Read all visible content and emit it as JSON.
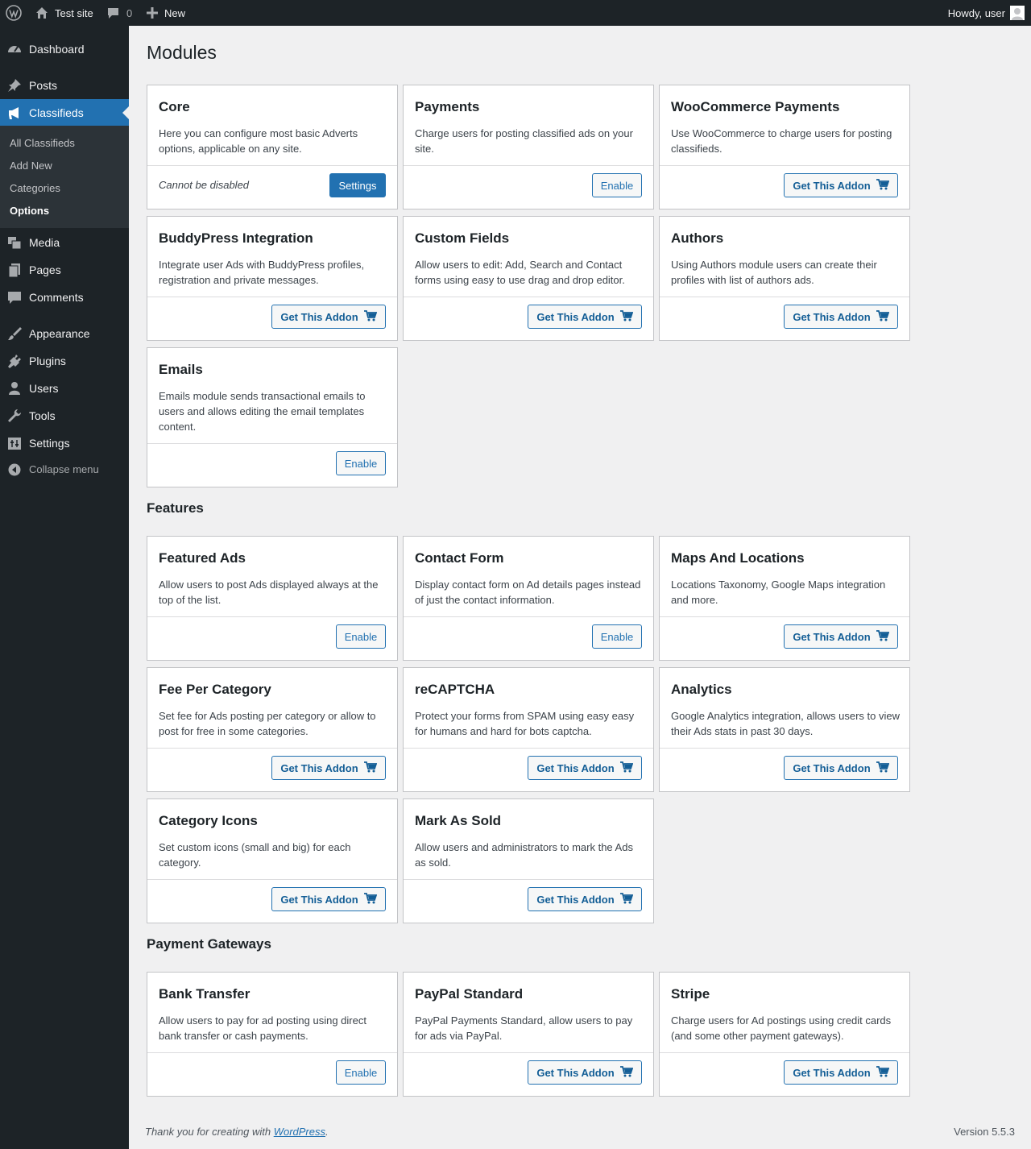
{
  "adminbar": {
    "site_name": "Test site",
    "comments_count": "0",
    "new_label": "New",
    "howdy": "Howdy, user"
  },
  "sidebar": {
    "items": [
      {
        "label": "Dashboard",
        "icon": "dashboard-icon"
      },
      {
        "label": "Posts",
        "icon": "pin-icon"
      },
      {
        "label": "Classifieds",
        "icon": "megaphone-icon"
      },
      {
        "label": "Media",
        "icon": "media-icon"
      },
      {
        "label": "Pages",
        "icon": "pages-icon"
      },
      {
        "label": "Comments",
        "icon": "comment-icon"
      },
      {
        "label": "Appearance",
        "icon": "brush-icon"
      },
      {
        "label": "Plugins",
        "icon": "plug-icon"
      },
      {
        "label": "Users",
        "icon": "user-icon"
      },
      {
        "label": "Tools",
        "icon": "wrench-icon"
      },
      {
        "label": "Settings",
        "icon": "settings-icon"
      }
    ],
    "submenu": [
      "All Classifieds",
      "Add New",
      "Categories",
      "Options"
    ],
    "collapse_label": "Collapse menu"
  },
  "page_title": "Modules",
  "sections": {
    "features": "Features",
    "gateways": "Payment Gateways"
  },
  "labels": {
    "settings": "Settings",
    "enable": "Enable",
    "get_addon": "Get This Addon",
    "cannot_disable": "Cannot be disabled"
  },
  "cards": [
    {
      "title": "Core",
      "desc": "Here you can configure most basic Adverts options, applicable on any site."
    },
    {
      "title": "Payments",
      "desc": "Charge users for posting classified ads on your site."
    },
    {
      "title": "WooCommerce Payments",
      "desc": "Use WooCommerce to charge users for posting classifieds."
    },
    {
      "title": "BuddyPress Integration",
      "desc": "Integrate user Ads with BuddyPress profiles, registration and private messages."
    },
    {
      "title": "Custom Fields",
      "desc": "Allow users to edit: Add, Search and Contact forms using easy to use drag and drop editor."
    },
    {
      "title": "Authors",
      "desc": "Using Authors module users can create their profiles with list of authors ads."
    },
    {
      "title": "Emails",
      "desc": "Emails module sends transactional emails to users and allows editing the email templates content."
    },
    {
      "title": "Featured Ads",
      "desc": "Allow users to post Ads displayed always at the top of the list."
    },
    {
      "title": "Contact Form",
      "desc": "Display contact form on Ad details pages instead of just the contact information."
    },
    {
      "title": "Maps And Locations",
      "desc": "Locations Taxonomy, Google Maps integration and more."
    },
    {
      "title": "Fee Per Category",
      "desc": "Set fee for Ads posting per category or allow to post for free in some categories."
    },
    {
      "title": "reCAPTCHA",
      "desc": "Protect your forms from SPAM using easy easy for humans and hard for bots captcha."
    },
    {
      "title": "Analytics",
      "desc": "Google Analytics integration, allows users to view their Ads stats in past 30 days."
    },
    {
      "title": "Category Icons",
      "desc": "Set custom icons (small and big) for each category."
    },
    {
      "title": "Mark As Sold",
      "desc": "Allow users and administrators to mark the Ads as sold."
    },
    {
      "title": "Bank Transfer",
      "desc": "Allow users to pay for ad posting using direct bank transfer or cash payments."
    },
    {
      "title": "PayPal Standard",
      "desc": "PayPal Payments Standard, allow users to pay for ads via PayPal."
    },
    {
      "title": "Stripe",
      "desc": "Charge users for Ad postings using credit cards (and some other payment gateways)."
    }
  ],
  "footer": {
    "text_before": "Thank you for creating with ",
    "link": "WordPress",
    "text_after": ".",
    "version": "Version 5.5.3"
  }
}
